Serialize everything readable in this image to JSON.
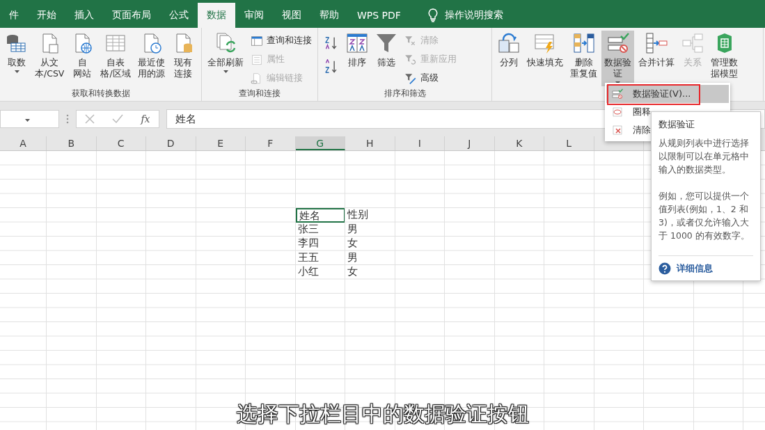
{
  "ribbon_tabs": [
    {
      "label": "件",
      "selected": false
    },
    {
      "label": "开始",
      "selected": false
    },
    {
      "label": "插入",
      "selected": false
    },
    {
      "label": "页面布局",
      "selected": false
    },
    {
      "label": "公式",
      "selected": false
    },
    {
      "label": "数据",
      "selected": true
    },
    {
      "label": "审阅",
      "selected": false
    },
    {
      "label": "视图",
      "selected": false
    },
    {
      "label": "帮助",
      "selected": false
    },
    {
      "label": "WPS PDF",
      "selected": false
    }
  ],
  "tell_me": "操作说明搜索",
  "ribbon_groups": [
    {
      "label": "获取和转换数据",
      "items": [
        {
          "kind": "large",
          "label_lines": [
            "取数"
          ],
          "dropdown": true,
          "disabled": false
        },
        {
          "kind": "large",
          "label_lines": [
            "从文",
            "本/CSV"
          ],
          "dropdown": false,
          "disabled": false
        },
        {
          "kind": "large",
          "label_lines": [
            "自",
            "网站"
          ],
          "dropdown": false,
          "disabled": false
        },
        {
          "kind": "large",
          "label_lines": [
            "自表",
            "格/区域"
          ],
          "dropdown": false,
          "disabled": false
        },
        {
          "kind": "large",
          "label_lines": [
            "最近使",
            "用的源"
          ],
          "dropdown": false,
          "disabled": false
        },
        {
          "kind": "large",
          "label_lines": [
            "现有",
            "连接"
          ],
          "dropdown": false,
          "disabled": false
        }
      ]
    },
    {
      "label": "查询和连接",
      "items": [
        {
          "kind": "large",
          "label_lines": [
            "全部刷新"
          ],
          "dropdown": true,
          "disabled": false
        },
        {
          "kind": "small_stack",
          "buttons": [
            {
              "label": "查询和连接",
              "disabled": false
            },
            {
              "label": "属性",
              "disabled": true
            },
            {
              "label": "编辑链接",
              "disabled": true
            }
          ]
        }
      ]
    },
    {
      "label": "排序和筛选",
      "items": [
        {
          "kind": "sort_pair"
        },
        {
          "kind": "large",
          "label_lines": [
            "排序"
          ],
          "dropdown": false,
          "disabled": false
        },
        {
          "kind": "large",
          "label_lines": [
            "筛选"
          ],
          "dropdown": false,
          "disabled": false
        },
        {
          "kind": "small_stack",
          "buttons": [
            {
              "label": "清除",
              "disabled": true
            },
            {
              "label": "重新应用",
              "disabled": true
            },
            {
              "label": "高级",
              "disabled": false
            }
          ]
        }
      ]
    },
    {
      "items": [
        {
          "kind": "large",
          "label_lines": [
            "分列"
          ],
          "dropdown": false,
          "disabled": false
        },
        {
          "kind": "large",
          "label_lines": [
            "快速填充"
          ],
          "dropdown": false,
          "disabled": false
        },
        {
          "kind": "large",
          "label_lines": [
            "删除",
            "重复值"
          ],
          "dropdown": false,
          "disabled": false
        },
        {
          "kind": "large",
          "label_lines": [
            "数据验",
            "证"
          ],
          "dropdown": true,
          "disabled": false,
          "selected": true
        },
        {
          "kind": "large",
          "label_lines": [
            "合并计算"
          ],
          "dropdown": false,
          "disabled": false
        },
        {
          "kind": "large",
          "label_lines": [
            "关系"
          ],
          "dropdown": false,
          "disabled": true
        },
        {
          "kind": "large",
          "label_lines": [
            "管理数",
            "据模型"
          ],
          "dropdown": false,
          "disabled": false
        }
      ]
    }
  ],
  "formula_bar": {
    "fx": "fx",
    "value": "姓名"
  },
  "sheet": {
    "column_headers": [
      {
        "label": "A",
        "selected": false
      },
      {
        "label": "B",
        "selected": false
      },
      {
        "label": "C",
        "selected": false
      },
      {
        "label": "D",
        "selected": false
      },
      {
        "label": "E",
        "selected": false
      },
      {
        "label": "F",
        "selected": false
      },
      {
        "label": "G",
        "selected": true
      },
      {
        "label": "H",
        "selected": false
      },
      {
        "label": "I",
        "selected": false
      },
      {
        "label": "J",
        "selected": false
      },
      {
        "label": "K",
        "selected": false
      },
      {
        "label": "L",
        "selected": false
      }
    ],
    "rows": [
      [
        {
          "value": "姓名",
          "selected": true
        },
        {
          "value": "性别",
          "selected": false
        }
      ],
      [
        {
          "value": "张三",
          "selected": false
        },
        {
          "value": "男",
          "selected": false
        }
      ],
      [
        {
          "value": "李四",
          "selected": false
        },
        {
          "value": "女",
          "selected": false
        }
      ],
      [
        {
          "value": "王五",
          "selected": false
        },
        {
          "value": "男",
          "selected": false
        }
      ],
      [
        {
          "value": "小红",
          "selected": false
        },
        {
          "value": "女",
          "selected": false
        }
      ]
    ]
  },
  "dropdown_menu": {
    "items": [
      {
        "label": "数据验证(V)...",
        "selected": true
      },
      {
        "label": "圈释",
        "selected": false
      },
      {
        "label": "清除",
        "selected": false
      }
    ]
  },
  "tooltip": {
    "title": "数据验证",
    "paragraphs": [
      "从规则列表中进行选择以限制可以在单元格中输入的数据类型。",
      "例如，您可以提供一个值列表(例如，1、2 和 3)，或者仅允许输入大于 1000 的有效数字。"
    ],
    "link": "详细信息"
  },
  "caption": "选择下拉栏目中的数据验证按钮"
}
